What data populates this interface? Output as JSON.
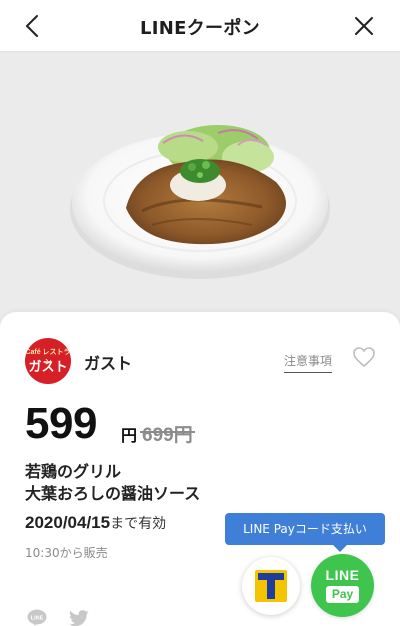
{
  "header": {
    "title": "LINEクーポン",
    "back_icon": "chevron-left-icon",
    "close_icon": "close-icon"
  },
  "photo": {
    "description_icon": "food-photo"
  },
  "coupon": {
    "brand": {
      "logo_small_text": "Café レストラン",
      "logo_main_text": "ガスト",
      "name": "ガスト"
    },
    "notice_label": "注意事項",
    "favorite_icon": "heart-icon",
    "price": {
      "current": "599",
      "unit": "円",
      "original": "699円"
    },
    "item_name_line1": "若鶏のグリル",
    "item_name_line2": "大葉おろしの醤油ソース",
    "expiry_date": "2020/04/15",
    "expiry_suffix": "まで有効",
    "sale_time": "10:30から販売"
  },
  "share": {
    "line_icon": "line-icon",
    "twitter_icon": "twitter-icon",
    "line_label": "LINE"
  },
  "payment": {
    "tooltip": "LINE Payコード支払い",
    "tpoint_icon": "tpoint-icon",
    "linepay_line": "LINE",
    "linepay_pay": "Pay"
  },
  "colors": {
    "brand_red": "#d61f26",
    "linepay_green": "#3fc54d",
    "tooltip_blue": "#3f7fd7",
    "tpoint_blue": "#1f3d9a",
    "tpoint_yellow": "#f5c400"
  }
}
